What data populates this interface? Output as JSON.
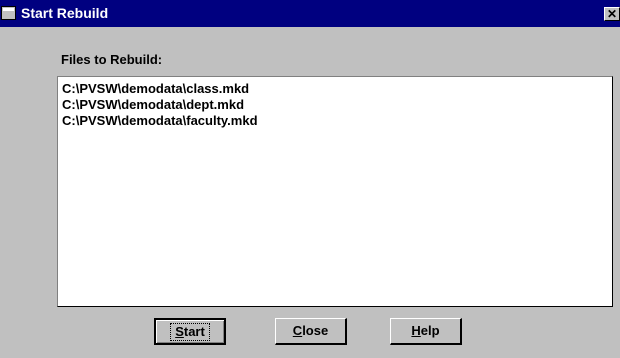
{
  "window": {
    "title": "Start Rebuild",
    "close_glyph": "✕"
  },
  "main": {
    "files_label": "Files to Rebuild:",
    "files": [
      "C:\\PVSW\\demodata\\class.mkd",
      "C:\\PVSW\\demodata\\dept.mkd",
      "C:\\PVSW\\demodata\\faculty.mkd"
    ]
  },
  "buttons": {
    "start": {
      "mnemonic": "S",
      "rest": "tart"
    },
    "close": {
      "mnemonic": "C",
      "rest": "lose"
    },
    "help": {
      "mnemonic": "H",
      "rest": "elp"
    }
  },
  "colors": {
    "titlebar": "#000080",
    "face": "#c0c0c0",
    "list_bg": "#ffffff"
  },
  "icons": {
    "system_menu": "window-icon",
    "close": "close-icon"
  }
}
